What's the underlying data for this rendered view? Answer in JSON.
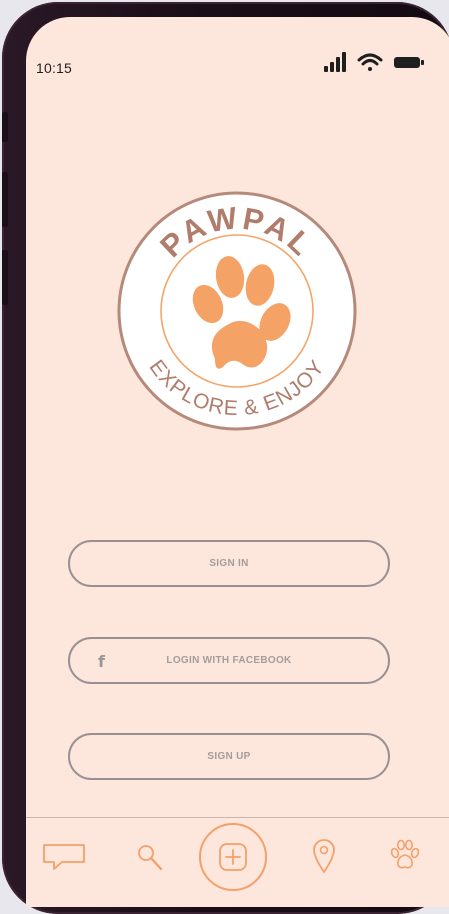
{
  "status_bar": {
    "time": "10:15",
    "icons": [
      "signal-icon",
      "wifi-icon",
      "battery-icon"
    ]
  },
  "logo": {
    "brand_text": "PAWPAL",
    "tagline": "EXPLORE & ENJOY",
    "colors": {
      "ring": "#b58a7a",
      "paw": "#f5a266",
      "text": "#b07d6c"
    }
  },
  "buttons": {
    "sign_in": "SIGN IN",
    "facebook": "LOGIN WITH FACEBOOK",
    "facebook_glyph": "f",
    "sign_up": "SIGN UP"
  },
  "tab_bar": {
    "items": [
      "chat-icon",
      "search-icon",
      "add-icon",
      "location-icon",
      "paw-icon"
    ],
    "accent": "#f4a06a"
  },
  "theme": {
    "background": "#fde6db",
    "button_border": "#9a8f92",
    "button_text": "#a39c9e"
  }
}
